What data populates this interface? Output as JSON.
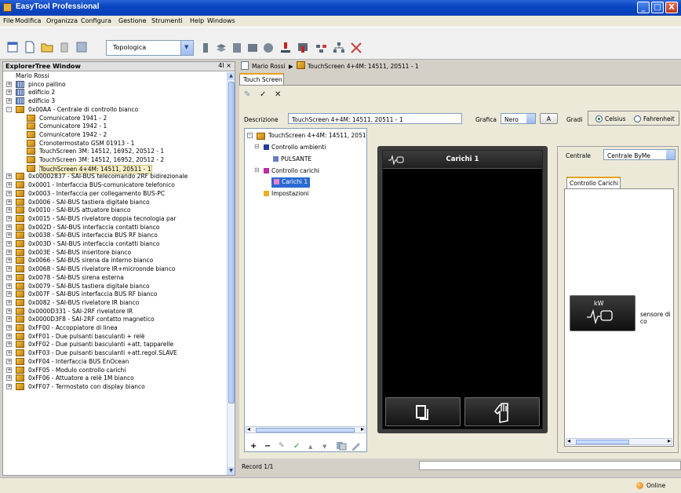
{
  "window": {
    "title": "EasyTool Professional",
    "controls": [
      "_",
      "□",
      "X"
    ]
  },
  "menu": [
    "File",
    "Modifica",
    "Organizza",
    "Configura",
    "Gestione",
    "Strumenti",
    "Help",
    "Windows"
  ],
  "toolbar": {
    "topology_select": "Topologica"
  },
  "explorer": {
    "title": "ExplorerTree Window",
    "pin_label": "4I ×",
    "items": [
      {
        "label": "Mario Rossi",
        "icon": "none",
        "toggle": "",
        "indent": 0
      },
      {
        "label": "pinco pallino",
        "icon": "building-icon",
        "toggle": "+",
        "indent": 0
      },
      {
        "label": "edificio 2",
        "icon": "building-icon",
        "toggle": "+",
        "indent": 0
      },
      {
        "label": "edificio 3",
        "icon": "building-icon",
        "toggle": "+",
        "indent": 0
      },
      {
        "label": "0x00AA - Centrale di controllo bianco",
        "icon": "device-icon",
        "toggle": "-",
        "indent": 0
      },
      {
        "label": "Comunicatore 1941 - 2",
        "icon": "device-icon",
        "toggle": "",
        "indent": 1
      },
      {
        "label": "Comunicatore 1942 - 1",
        "icon": "device-icon",
        "toggle": "",
        "indent": 1
      },
      {
        "label": "Comunicatore 1942 - 2",
        "icon": "device-icon",
        "toggle": "",
        "indent": 1
      },
      {
        "label": "Cronotermostato GSM 01913 - 1",
        "icon": "device-icon",
        "toggle": "",
        "indent": 1
      },
      {
        "label": "TouchScreen 3M: 14512, 16952, 20512 - 1",
        "icon": "device-icon",
        "toggle": "",
        "indent": 1
      },
      {
        "label": "TouchScreen 3M: 14512, 16952, 20512 - 2",
        "icon": "device-icon",
        "toggle": "",
        "indent": 1
      },
      {
        "label": "TouchScreen 4+4M: 14511, 20511 - 1",
        "icon": "device-icon",
        "toggle": "",
        "indent": 1,
        "selected": true
      },
      {
        "label": "0x00002837 - SAI-BUS telecomando 2RF bidirezionale",
        "icon": "device-icon",
        "toggle": "+",
        "indent": 0
      },
      {
        "label": "0x0001 - Interfaccia BUS-comunicatore telefonico",
        "icon": "device-icon",
        "toggle": "+",
        "indent": 0
      },
      {
        "label": "0x0003 - Interfaccia per collegamento BUS-PC",
        "icon": "device-icon",
        "toggle": "+",
        "indent": 0
      },
      {
        "label": "0x0006 - SAI-BUS tastiera digitale bianco",
        "icon": "device-icon",
        "toggle": "+",
        "indent": 0
      },
      {
        "label": "0x0010 - SAI-BUS attuatore bianco",
        "icon": "device-icon",
        "toggle": "+",
        "indent": 0
      },
      {
        "label": "0x0015 - SAI-BUS rivelatore doppia tecnologia par",
        "icon": "device-icon",
        "toggle": "+",
        "indent": 0
      },
      {
        "label": "0x002D - SAI-BUS interfaccia contatti bianco",
        "icon": "device-icon",
        "toggle": "+",
        "indent": 0
      },
      {
        "label": "0x0038 - SAI-BUS interfaccia BUS RF bianco",
        "icon": "device-icon",
        "toggle": "+",
        "indent": 0
      },
      {
        "label": "0x003D - SAI-BUS interfaccia contatti bianco",
        "icon": "device-icon",
        "toggle": "+",
        "indent": 0
      },
      {
        "label": "0x003E - SAI-BUS inseritore bianco",
        "icon": "device-icon",
        "toggle": "+",
        "indent": 0
      },
      {
        "label": "0x0066 - SAI-BUS sirena da interno bianco",
        "icon": "device-icon",
        "toggle": "+",
        "indent": 0
      },
      {
        "label": "0x0068 - SAI-BUS rivelatore IR+microonde bianco",
        "icon": "device-icon",
        "toggle": "+",
        "indent": 0
      },
      {
        "label": "0x0078 - SAI-BUS sirena esterna",
        "icon": "device-icon",
        "toggle": "+",
        "indent": 0
      },
      {
        "label": "0x0079 - SAI-BUS tastiera digitale bianco",
        "icon": "device-icon",
        "toggle": "+",
        "indent": 0
      },
      {
        "label": "0x007F - SAI-BUS interfaccia BUS RF bianco",
        "icon": "device-icon",
        "toggle": "+",
        "indent": 0
      },
      {
        "label": "0x0082 - SAI-BUS rivelatore IR bianco",
        "icon": "device-icon",
        "toggle": "+",
        "indent": 0
      },
      {
        "label": "0x0000D331 - SAI-2RF rivelatore IR",
        "icon": "device-icon",
        "toggle": "+",
        "indent": 0
      },
      {
        "label": "0x0000D3F8 - SAI-2RF contatto magnetico",
        "icon": "device-icon",
        "toggle": "+",
        "indent": 0
      },
      {
        "label": "0xFF00 - Accoppiatore di linea",
        "icon": "device-icon",
        "toggle": "+",
        "indent": 0
      },
      {
        "label": "0xFF01 - Due pulsanti basculanti + relè",
        "icon": "device-icon",
        "toggle": "+",
        "indent": 0
      },
      {
        "label": "0xFF02 - Due pulsanti basculanti +att. tapparelle",
        "icon": "device-icon",
        "toggle": "+",
        "indent": 0
      },
      {
        "label": "0xFF03 - Due pulsanti basculanti +att.regol.SLAVE",
        "icon": "device-icon",
        "toggle": "+",
        "indent": 0
      },
      {
        "label": "0xFF04 - Interfaccia BUS EnOcean",
        "icon": "device-icon",
        "toggle": "+",
        "indent": 0
      },
      {
        "label": "0xFF05 - Modulo controllo carichi",
        "icon": "device-icon",
        "toggle": "+",
        "indent": 0
      },
      {
        "label": "0xFF06 - Attuatore a relè 1M bianco",
        "icon": "device-icon",
        "toggle": "+",
        "indent": 0
      },
      {
        "label": "0xFF07 - Termostato con display bianco",
        "icon": "device-icon",
        "toggle": "+",
        "indent": 0
      }
    ]
  },
  "breadcrumb": {
    "parent": "Mario Rossi",
    "separator": "▶",
    "current": "TouchScreen 4+4M: 14511, 20511 - 1"
  },
  "tab": {
    "label": "Touch Screen"
  },
  "actions": {
    "edit": "✎",
    "confirm": "✓",
    "cancel": "✕"
  },
  "form": {
    "descrizione_label": "Descrizione",
    "descrizione_value": "TouchScreen 4+4M: 14511, 20511 - 1",
    "grafica_label": "Grafica",
    "grafica_value": "Nero",
    "a_button": "A",
    "gradi_label": "Gradi",
    "celsius": "Celsius",
    "fahrenheit": "Fahrenheit"
  },
  "config_tree": {
    "root": "TouchScreen 4+4M: 14511, 2051",
    "items": [
      {
        "label": "Controllo ambienti",
        "color": "#2a3a9a"
      },
      {
        "label": "PULSANTE",
        "color": "#6a7ac8"
      },
      {
        "label": "Controllo carichi",
        "color": "#c02a9a"
      },
      {
        "label": "Carichi 1",
        "color": "#e060c0"
      },
      {
        "label": "Impostazioni",
        "color": "#e8b020"
      }
    ],
    "bottom_tools": [
      "+",
      "−",
      "✎",
      "✓",
      "▲",
      "▼"
    ]
  },
  "screen": {
    "title": "Carichi 1"
  },
  "right_panel": {
    "centrale_label": "Centrale",
    "centrale_value": "Centrale ByMe",
    "tab_label": "Controllo Carichi",
    "kw_label": "kW",
    "sensor_label": "sensore di co"
  },
  "record": "Record 1/1",
  "status": {
    "online": "Online"
  }
}
